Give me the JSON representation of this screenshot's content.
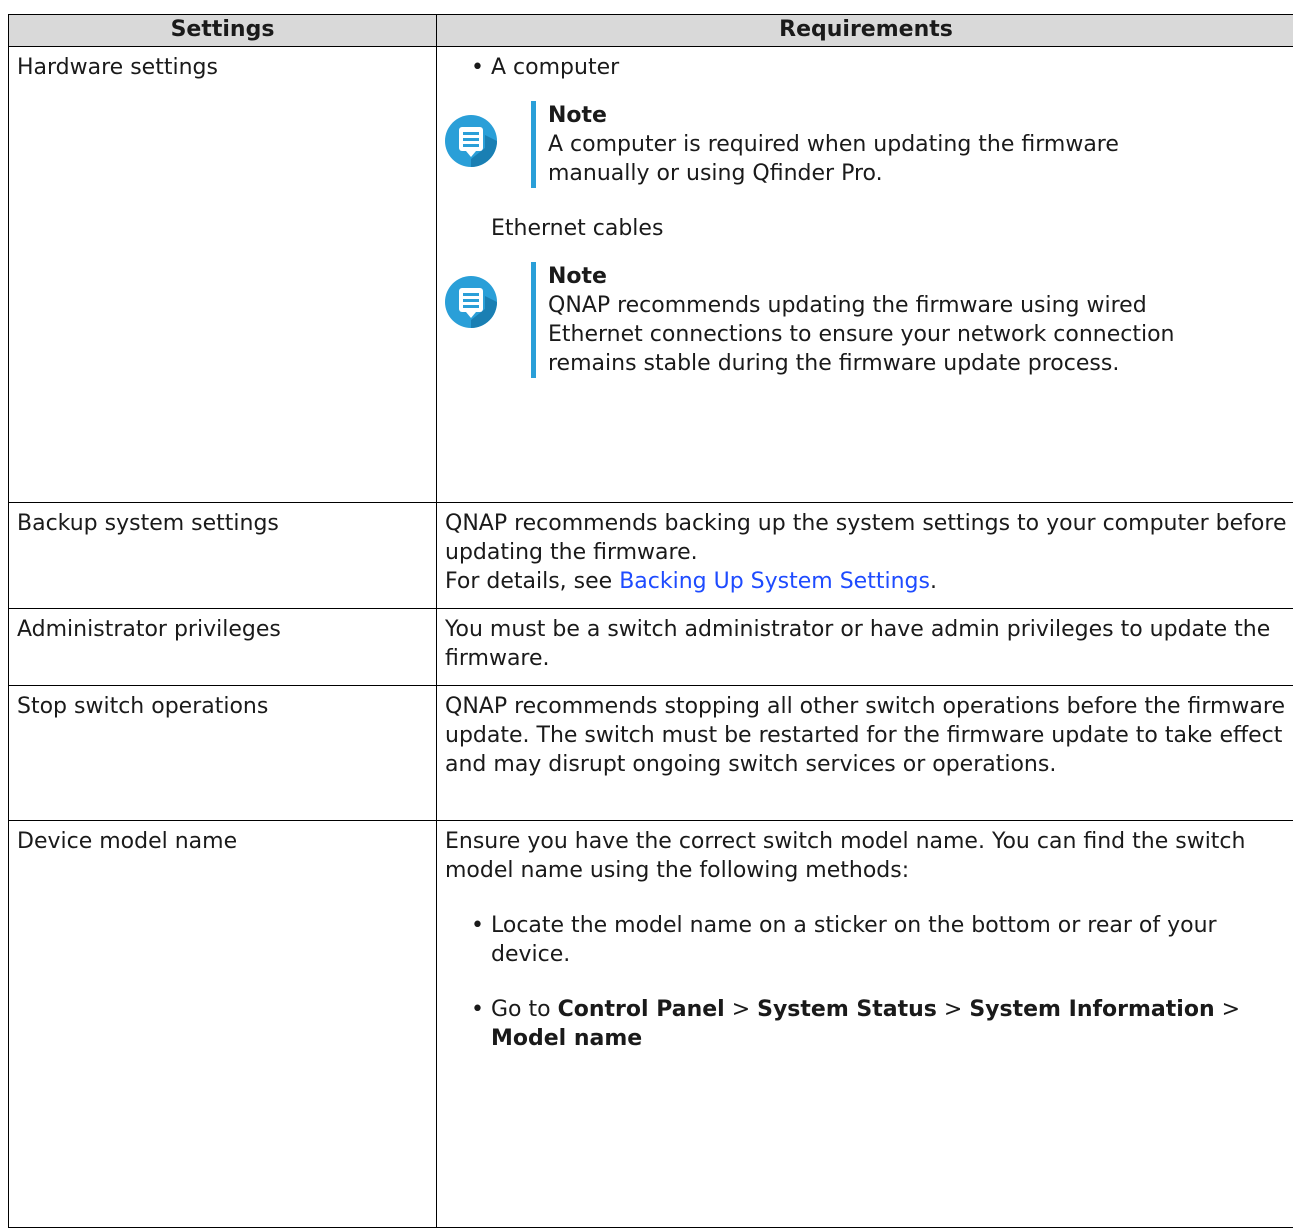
{
  "table": {
    "headers": [
      "Settings",
      "Requirements"
    ],
    "hardware": {
      "setting": "Hardware settings",
      "item1": "A computer",
      "note1_title": "Note",
      "note1_text": "A computer is required when updating the firmware manually or using Qfinder Pro.",
      "item2": "Ethernet cables",
      "note2_title": "Note",
      "note2_text": "QNAP recommends updating the firmware using wired Ethernet connections to ensure your network connection remains stable during the firmware update process."
    },
    "backup": {
      "setting": "Backup system settings",
      "text": "QNAP recommends backing up the system settings to your computer before updating the firmware.",
      "details_prefix": "For details, see ",
      "details_link": "Backing Up System Settings",
      "details_suffix": "."
    },
    "admin": {
      "setting": "Administrator privileges",
      "text": "You must be a switch administrator or have admin privileges to update the firmware."
    },
    "stop": {
      "setting": "Stop switch operations",
      "text": "QNAP recommends stopping all other switch operations before the firmware update. The switch must be restarted for the firmware update to take effect and may disrupt ongoing switch services or operations."
    },
    "model": {
      "setting": "Device model name",
      "text": "Ensure you have the correct switch model name. You can find the switch model name using the following methods:",
      "method1": "Locate the model name on a sticker on the bottom or rear of your device.",
      "method2_prefix": "Go to ",
      "method2_path1": "Control Panel",
      "sep": " > ",
      "method2_path2": "System Status",
      "method2_path3": "System Information",
      "method2_path4": "Model name"
    }
  },
  "icons": {
    "note": "note-speech-bubble-icon"
  },
  "colors": {
    "accent": "#2a9fd8",
    "link": "#1e4bff",
    "header_bg": "#d9d9d9"
  }
}
